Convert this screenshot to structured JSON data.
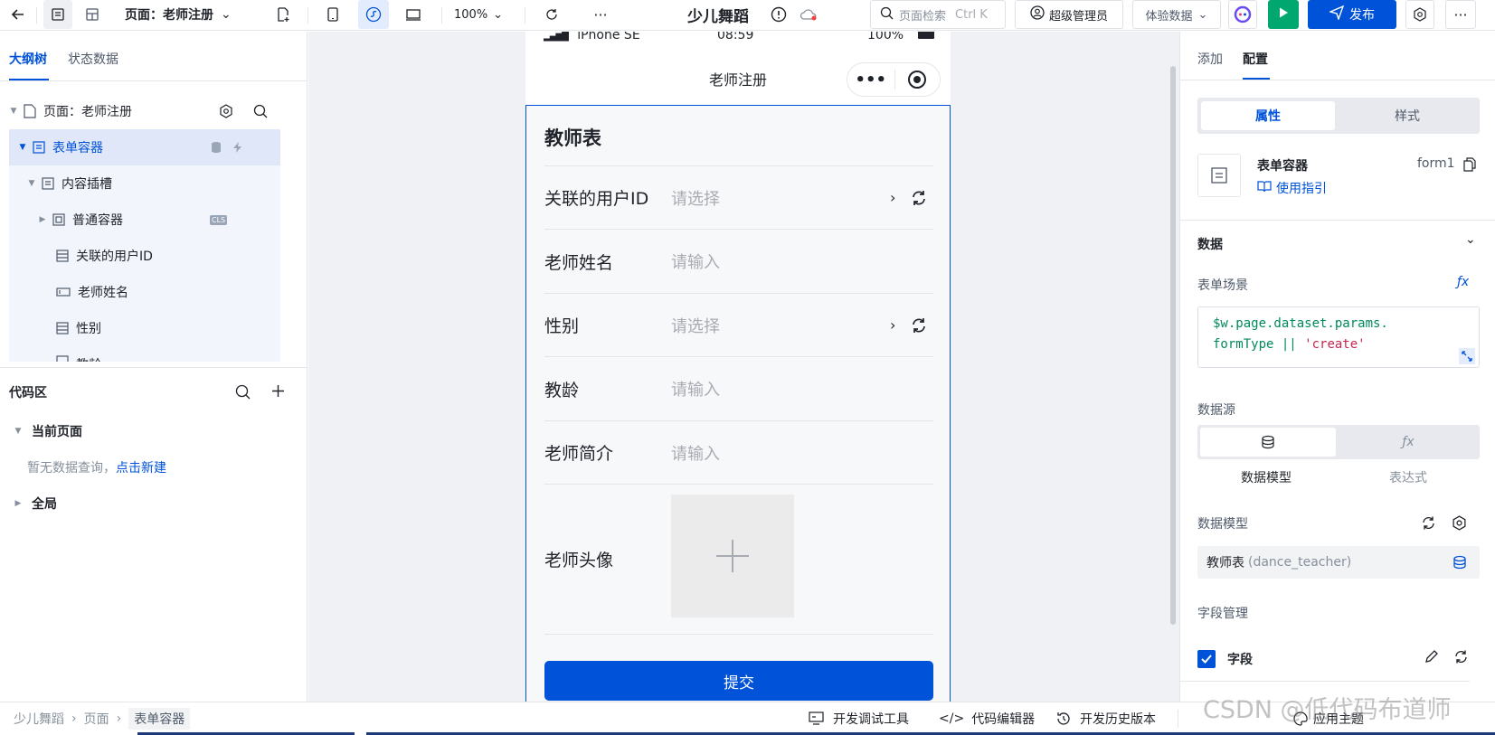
{
  "topbar": {
    "page_label": "页面：老师注册",
    "zoom": "100%",
    "app_title": "少儿舞蹈",
    "search_placeholder": "页面检索",
    "search_shortcut": "Ctrl K",
    "admin_label": "超级管理员",
    "data_label": "体验数据",
    "publish_label": "发布"
  },
  "left": {
    "tab_outline": "大纲树",
    "tab_state": "状态数据",
    "tree": [
      {
        "label": "页面：老师注册"
      },
      {
        "label": "表单容器"
      },
      {
        "label": "内容插槽"
      },
      {
        "label": "普通容器",
        "badge": "CLS"
      },
      {
        "label": "关联的用户ID"
      },
      {
        "label": "老师姓名"
      },
      {
        "label": "性别"
      },
      {
        "label": "教龄"
      }
    ],
    "code_title": "代码区",
    "current_page": "当前页面",
    "no_query": "暂无数据查询，",
    "create_link": "点击新建",
    "global": "全局"
  },
  "phone": {
    "device": "iPhone SE",
    "time": "08:59",
    "battery": "100%",
    "nav_title": "老师注册",
    "form_title": "教师表",
    "fields": [
      {
        "label": "关联的用户ID",
        "placeholder": "请选择"
      },
      {
        "label": "老师姓名",
        "placeholder": "请输入"
      },
      {
        "label": "性别",
        "placeholder": "请选择"
      },
      {
        "label": "教龄",
        "placeholder": "请输入"
      },
      {
        "label": "老师简介",
        "placeholder": "请输入"
      },
      {
        "label": "老师头像",
        "placeholder": ""
      }
    ],
    "submit_label": "提交"
  },
  "right": {
    "tab_add": "添加",
    "tab_config": "配置",
    "seg_props": "属性",
    "seg_style": "样式",
    "component_name": "表单容器",
    "component_id": "form1",
    "guide_link": "使用指引",
    "section_data": "数据",
    "form_scene_label": "表单场景",
    "code_line1": "$w.page.dataset.params.",
    "code_line2a": "formType || ",
    "code_line2b": "'create'",
    "datasource_label": "数据源",
    "ds_model": "数据模型",
    "ds_expr": "表达式",
    "model_label": "数据模型",
    "model_value": "教师表",
    "model_value_sub": "(dance_teacher)",
    "field_mgmt": "字段管理",
    "field_label": "字段"
  },
  "bottom": {
    "crumbs": [
      "少儿舞蹈",
      "页面",
      "表单容器"
    ],
    "debug_tools": "开发调试工具",
    "code_editor": "代码编辑器",
    "history": "开发历史版本",
    "theme": "应用主题"
  },
  "watermark": "CSDN @低代码布道师",
  "colors": {
    "primary": "#0052d9",
    "run_green": "#00a870"
  }
}
